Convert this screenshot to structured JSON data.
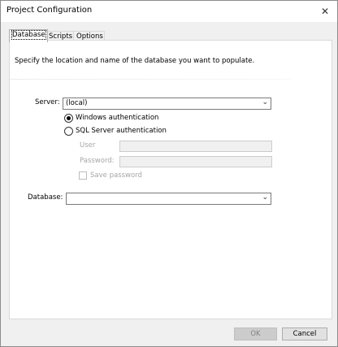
{
  "window": {
    "title": "Project Configuration",
    "close_glyph": "✕"
  },
  "tabs": [
    {
      "label": "Database",
      "active": true
    },
    {
      "label": "Scripts",
      "active": false
    },
    {
      "label": "Options",
      "active": false
    }
  ],
  "database_tab": {
    "description": "Specify the location and name of the database you want to populate.",
    "server_label": "Server:",
    "server_value": "(local)",
    "auth_windows_label": "Windows authentication",
    "auth_windows_selected": true,
    "auth_sql_label": "SQL Server authentication",
    "auth_sql_selected": false,
    "user_label": "User",
    "user_value": "",
    "password_label": "Password:",
    "password_value": "",
    "save_password_label": "Save password",
    "save_password_checked": false,
    "database_label": "Database:",
    "database_value": ""
  },
  "buttons": {
    "ok_label": "OK",
    "ok_enabled": false,
    "cancel_label": "Cancel"
  },
  "icons": {
    "dropdown": "chevron-down-icon",
    "close": "close-icon"
  }
}
